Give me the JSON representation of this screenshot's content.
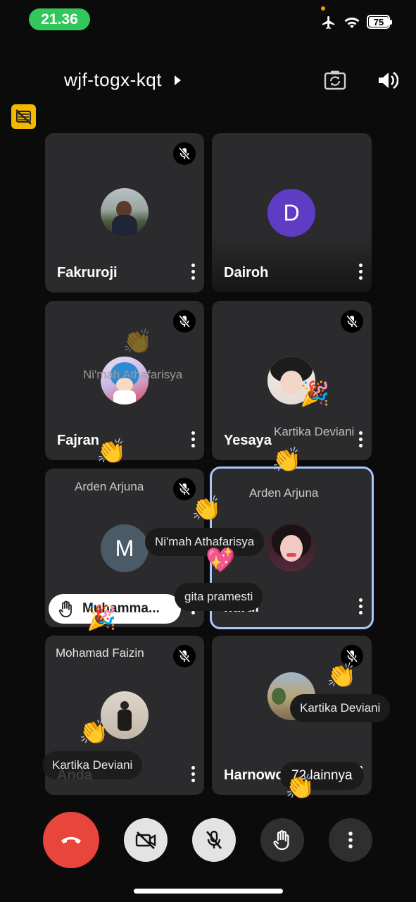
{
  "status_bar": {
    "time": "21.36",
    "battery_level": "75"
  },
  "header": {
    "meeting_code": "wjf-togx-kqt",
    "switch_camera_icon": "camera-switch-icon",
    "speaker_icon": "speaker-icon"
  },
  "tiles": [
    {
      "name": "Fakruroji",
      "muted": true,
      "avatar": "photo"
    },
    {
      "name": "Dairoh",
      "muted": false,
      "avatar_letter": "D",
      "avatar_color": "#5f3cc4"
    },
    {
      "name": "Fajran",
      "muted": true,
      "avatar": "photo"
    },
    {
      "name": "Yesaya",
      "muted": true,
      "avatar": "photo"
    },
    {
      "name": "Muhammad",
      "muted": true,
      "avatar_letter": "M",
      "avatar_color": "#4a5a66"
    },
    {
      "name": "nurul",
      "muted": false,
      "avatar": "photo",
      "active_speaker": true
    },
    {
      "name": "Anda",
      "muted": true,
      "avatar": "photo"
    },
    {
      "name": "Harnowo",
      "muted": true,
      "avatar": "photo"
    }
  ],
  "raised_hand": {
    "label": "Muhamma..."
  },
  "others_chip": {
    "label": "72 lainnya"
  },
  "reactions": {
    "floating_names": [
      "Ni'mah Athafarisya",
      "Kartika Deviani",
      "Arden Arjuna",
      "Arden Arjuna",
      "Ni'mah Athafarisya",
      "gita pramesti",
      "Mohamad Faizin",
      "Kartika Deviani",
      "Kartika Deviani"
    ]
  },
  "controls": {
    "end_call": "end-call-icon",
    "camera": "camera-off-icon",
    "mic": "mic-off-icon",
    "hand": "raise-hand-icon",
    "more": "more-options-icon"
  },
  "colors": {
    "end_call": "#e8453c",
    "active_border": "#a8c7fa",
    "status_green": "#32c75a",
    "badge_yellow": "#f5b800"
  }
}
